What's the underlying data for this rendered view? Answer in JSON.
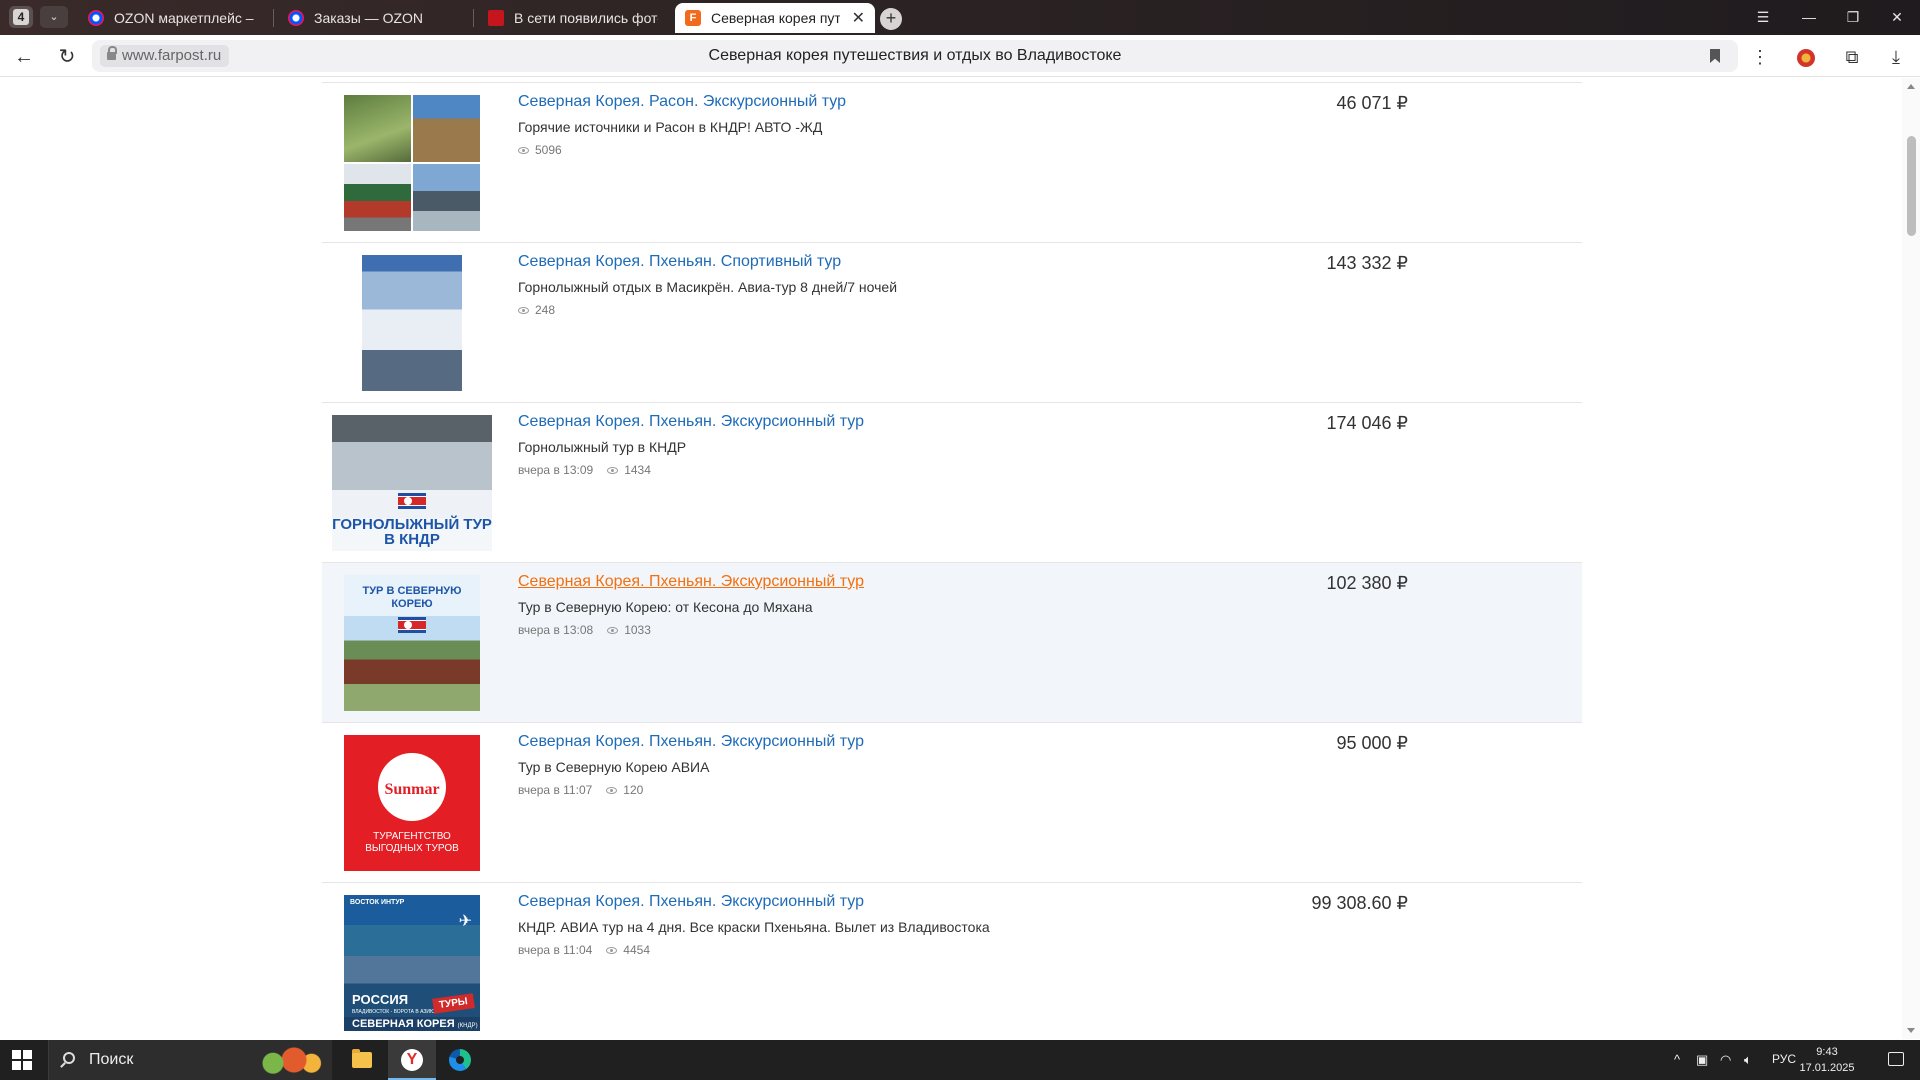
{
  "browser": {
    "tab_count": "4",
    "tabs": [
      {
        "title": "OZON маркетплейс – ми",
        "favicon": "ozon-icon"
      },
      {
        "title": "Заказы — OZON",
        "favicon": "ozon-icon"
      },
      {
        "title": "В сети появились фото пл",
        "favicon": "news-icon"
      },
      {
        "title": "Северная корея путеш",
        "favicon": "farpost-icon",
        "active": true
      }
    ],
    "farpost_fav_letter": "F",
    "url": "www.farpost.ru",
    "page_title": "Северная корея путешествия и отдых во Владивостоке"
  },
  "listings": [
    {
      "title": "Северная Корея. Расон. Экскурсионный тур",
      "description": "Горячие источники и Расон в КНДР! АВТО -ЖД",
      "date": "",
      "views": "5096",
      "price": "46 071 ₽",
      "thumb": "collage"
    },
    {
      "title": "Северная Корея. Пхеньян. Спортивный тур",
      "description": "Горнолыжный отдых в Масикрён. Авиа-тур 8 дней/7 ночей",
      "date": "",
      "views": "248",
      "price": "143 332 ₽",
      "thumb": "ski-poster"
    },
    {
      "title": "Северная Корея. Пхеньян. Экскурсионный тур",
      "description": "Горнолыжный тур в КНДР",
      "date": "вчера в 13:09",
      "views": "1434",
      "price": "174 046 ₽",
      "thumb": "ski-resort",
      "thumb_text": "ГОРНОЛЫЖНЫЙ ТУР В КНДР"
    },
    {
      "title": "Северная Корея. Пхеньян. Экскурсионный тур",
      "description": "Тур в Северную Корею: от Кесона до Мяхана",
      "date": "вчера в 13:08",
      "views": "1033",
      "price": "102 380 ₽",
      "thumb": "temple-tour",
      "thumb_text": "ТУР В СЕВЕРНУЮ КОРЕЮ",
      "hovered": true
    },
    {
      "title": "Северная Корея. Пхеньян. Экскурсионный тур",
      "description": "Тур в Северную Корею АВИА",
      "date": "вчера в 11:07",
      "views": "120",
      "price": "95 000 ₽",
      "thumb": "sunmar-logo",
      "thumb_logo": "Sunmar",
      "thumb_caption": "ТУРАГЕНТСТВО ВЫГОДНЫХ ТУРОВ"
    },
    {
      "title": "Северная Корея. Пхеньян. Экскурсионный тур",
      "description": "КНДР. АВИА тур на 4 дня. Все краски Пхеньяна. Вылет из Владивостока",
      "date": "вчера в 11:04",
      "views": "4454",
      "price": "99 308.60 ₽",
      "thumb": "vostok-intur",
      "thumb_brand": "ВОСТОК ИНТУР",
      "thumb_big": "РОССИЯ",
      "thumb_sub": "ВЛАДИВОСТОК - ВОРОТА В АЗИЮ",
      "thumb_country": "СЕВЕРНАЯ КОРЕЯ",
      "thumb_country_note": "(КНДР)",
      "thumb_tag": "ТУРЫ"
    }
  ],
  "taskbar": {
    "search_label": "Поиск",
    "language": "РУС",
    "time": "9:43",
    "date": "17.01.2025"
  }
}
